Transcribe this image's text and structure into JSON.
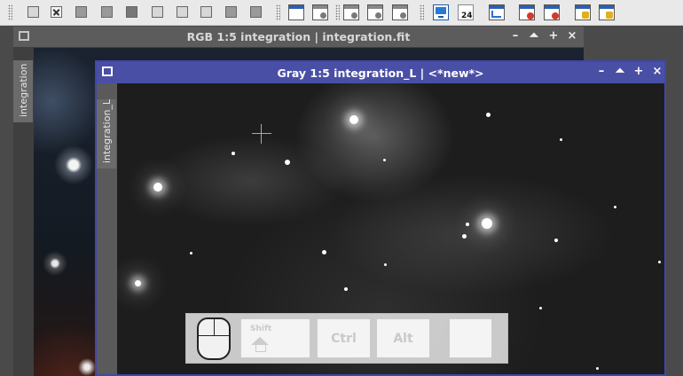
{
  "windows": {
    "back": {
      "title": "RGB 1:5 integration | integration.fit",
      "tab_label": "integration"
    },
    "front": {
      "title": "Gray 1:5 integration_L | <*new*>",
      "tab_label": "integration_L"
    },
    "buttons": {
      "minimize": "–",
      "shade": "⏶",
      "maximize": "+",
      "close": "×"
    }
  },
  "keyboard_overlay": {
    "shift_label": "Shift",
    "ctrl_label": "Ctrl",
    "alt_label": "Alt"
  },
  "toolbar_badge": "24",
  "colors": {
    "front_titlebar": "#4a4fa6",
    "back_titlebar": "#5c5c5c",
    "toolbar_bg": "#e9e9e9"
  },
  "icons": [
    "grip-icon",
    "new-image-icon",
    "close-image-icon",
    "square-icon",
    "window-icon",
    "monitor-icon",
    "tile-icon",
    "red-x-icon",
    "yellow-badge-icon"
  ]
}
